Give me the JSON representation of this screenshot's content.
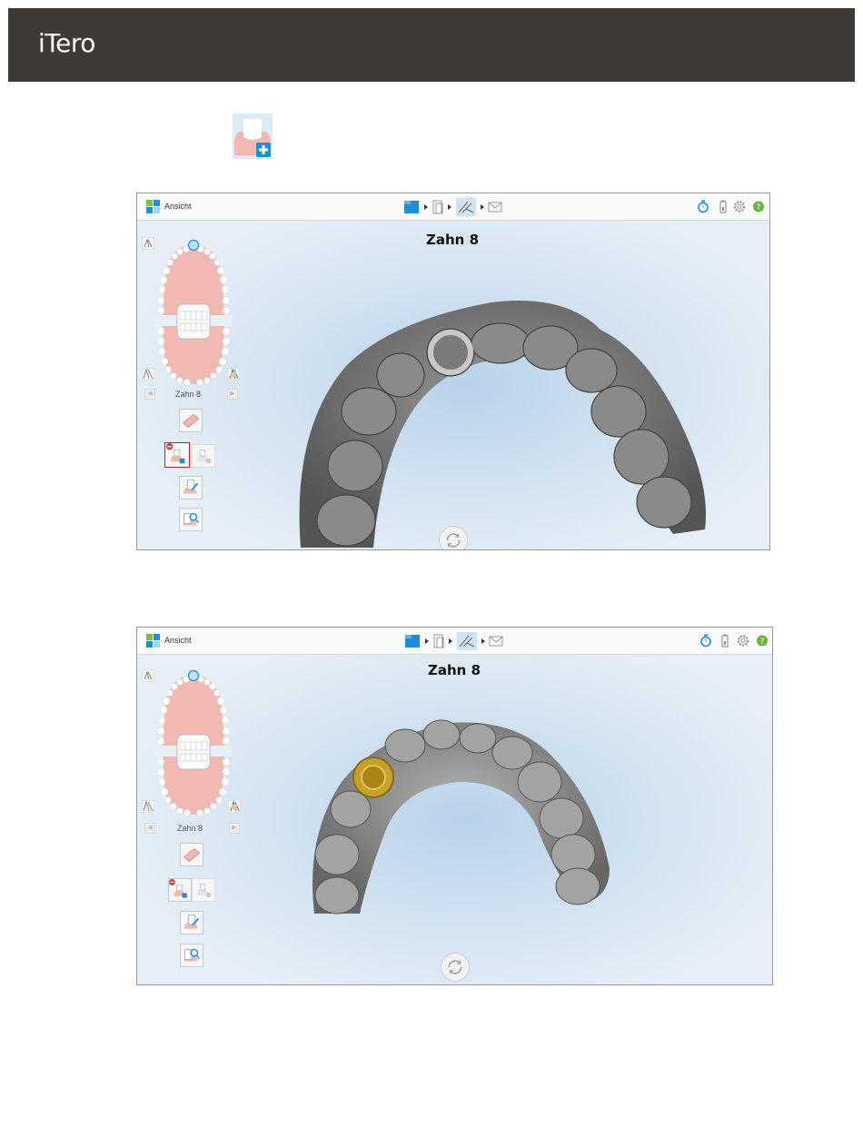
{
  "header": {
    "logo_text": "iTero",
    "background": "#3e3a36"
  },
  "shots": [
    {
      "view_label": "Ansicht",
      "tooth_title": "Zahn 8",
      "nav_label": "Zahn 8",
      "workflow_steps": [
        "rx-icon",
        "scan-icon",
        "view-icon",
        "send-icon"
      ],
      "active_step": "view-icon",
      "highlighted_tool": "remove-segment-button",
      "tooth_color": "gray"
    },
    {
      "view_label": "Ansicht",
      "tooth_title": "Zahn 8",
      "nav_label": "Zahn 8",
      "workflow_steps": [
        "rx-icon",
        "scan-icon",
        "view-icon",
        "send-icon"
      ],
      "active_step": "view-icon",
      "highlighted_tool": "",
      "tooth_color": "gold"
    }
  ],
  "colors": {
    "accent": "#1e8fd6",
    "gum": "#f2b8b2",
    "selected": "#c81d25",
    "help": "#6db33f",
    "gold": "#c9a227"
  }
}
